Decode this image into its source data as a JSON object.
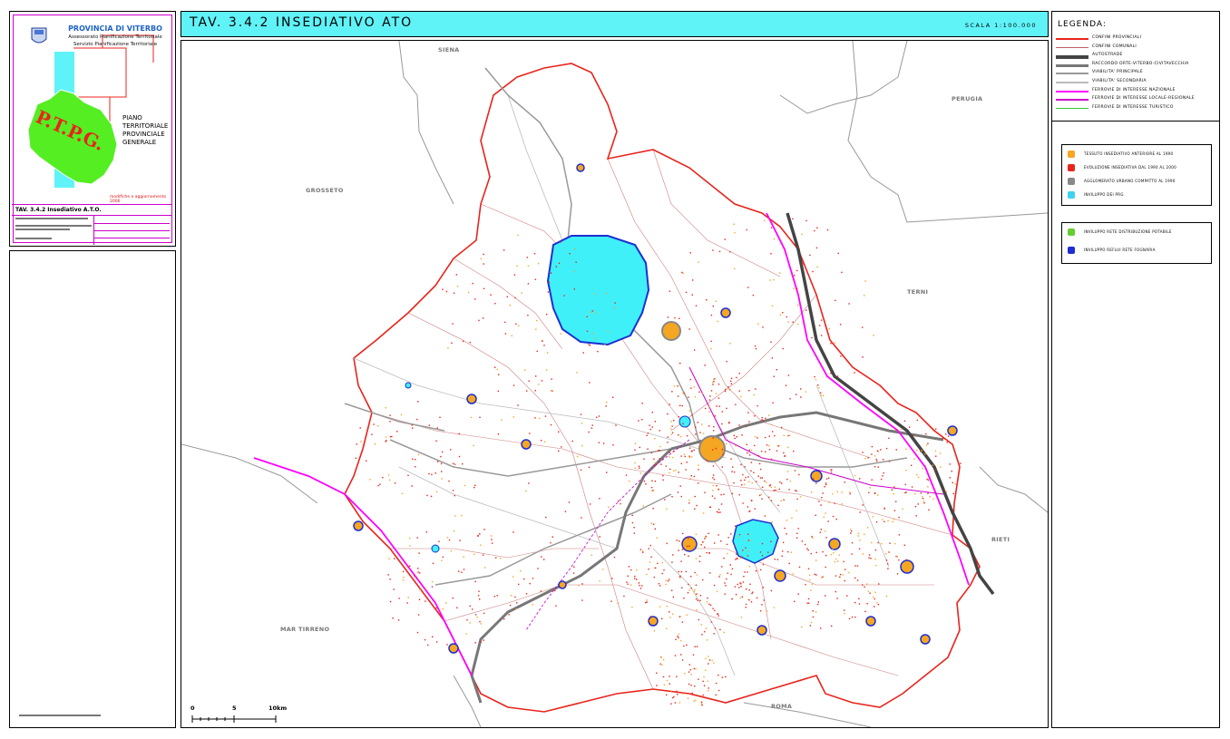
{
  "header": {
    "province": "PROVINCIA DI VITERBO",
    "dept_line1": "Assessorato Pianificazione Territoriale",
    "dept_line2": "Servizio Pianificazione Territoriale",
    "plan_line1": "PIANO",
    "plan_line2": "TERRITORIALE",
    "plan_line3": "PROVINCIALE",
    "plan_line4": "GENERALE",
    "logo_text": "P.T.P.G.",
    "update_note": "modifiche e aggiornamento 2006",
    "table_title": "TAV. 3.4.2 Insediativo A.T.O."
  },
  "title_bar": {
    "title": "TAV. 3.4.2 INSEDIATIVO ATO",
    "scale": "SCALA 1:100.000"
  },
  "places": {
    "siena": "SIENA",
    "perugia": "PERUGIA",
    "grosseto": "GROSSETO",
    "terni": "TERNI",
    "rieti": "RIETI",
    "mar_tirreno": "MAR TIRRENO",
    "roma": "ROMA"
  },
  "scalebar": {
    "n0": "0",
    "n5": "5",
    "n10": "10km"
  },
  "legend": {
    "title": "LEGENDA:",
    "lines": [
      {
        "label": "CONFINI PROVINCIALI",
        "color": "#e8241c"
      },
      {
        "label": "CONFINI COMUNALI",
        "color": "#c06060"
      },
      {
        "label": "AUTOSTRADE",
        "color": "#444444"
      },
      {
        "label": "RACCORDO ORTE-VITERBO-CIVITAVECCHIA",
        "color": "#777777"
      },
      {
        "label": "VIABILITA' PRINCIPALE",
        "color": "#999999"
      },
      {
        "label": "VIABILITA' SECONDARIA",
        "color": "#bbbbbb"
      },
      {
        "label": "FERROVIE DI INTERESSE NAZIONALE",
        "color": "#ff00ff"
      },
      {
        "label": "FERROVIE DI INTERESSE LOCALE-REGIONALE",
        "color": "#cc00cc"
      },
      {
        "label": "FERROVIE DI INTERESSE TURISTICO",
        "color": "#33cc33"
      }
    ],
    "box1": [
      {
        "label": "TESSUTO INSEDIATIVO ANTERIORE AL 1990",
        "color": "#f5a623"
      },
      {
        "label": "EVOLUZIONE INSEDIATIVA DAL 1990 AL 2000",
        "color": "#e8241c"
      },
      {
        "label": "AGGLOMERATO URBANO COMPATTO AL 1990",
        "color": "#888888"
      },
      {
        "label": "INVILUPPO DEI PRG",
        "color": "#3cd3f0"
      }
    ],
    "box2": [
      {
        "label": "INVILUPPO RETE DISTRIBUZIONE POTABILE",
        "color": "#66cc33"
      },
      {
        "label": "INVILUPPO REFLUI RETE FOGNARIA",
        "color": "#1c2fd1"
      }
    ]
  },
  "colors": {
    "title_bar": "#5ff3f8",
    "lake": "#40f0f8",
    "boundary": "#e8241c",
    "border_frame": "#cc00cc"
  }
}
